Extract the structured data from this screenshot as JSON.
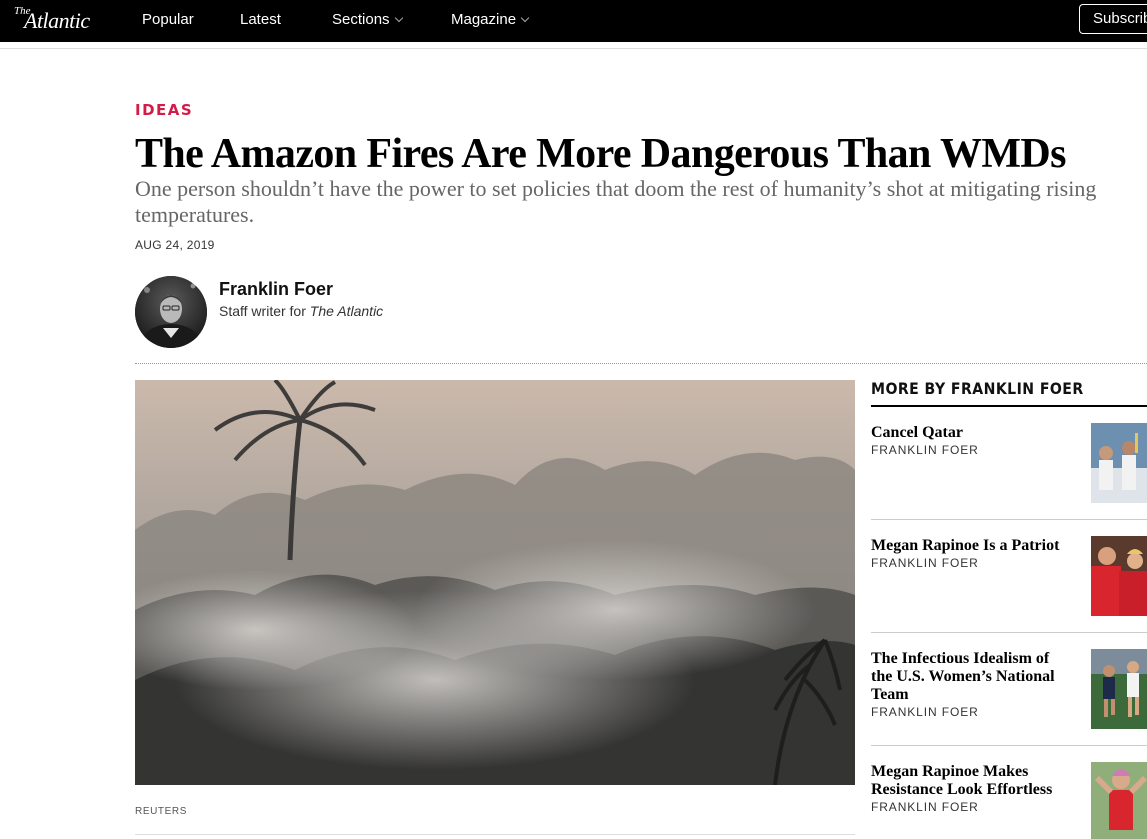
{
  "nav": {
    "logo_the": "The",
    "logo_name": "Atlantic",
    "items": [
      "Popular",
      "Latest",
      "Sections",
      "Magazine"
    ],
    "subscribe_label": "Subscribe"
  },
  "article": {
    "kicker": "IDEAS",
    "headline": "The Amazon Fires Are More Dangerous Than WMDs",
    "dek": "One person shouldn’t have the power to set policies that doom the rest of humanity’s shot at mitigating rising temperatures.",
    "date": "AUG 24, 2019",
    "author_name": "Franklin Foer",
    "author_role_prefix": "Staff writer for ",
    "author_role_pub": "The Atlantic",
    "image_credit": "REUTERS"
  },
  "sidebar": {
    "title": "MORE BY FRANKLIN FOER",
    "items": [
      {
        "title": "Cancel Qatar",
        "author": "FRANKLIN FOER"
      },
      {
        "title": "Megan Rapinoe Is a Patriot",
        "author": "FRANKLIN FOER"
      },
      {
        "title": "The Infectious Idealism of the U.S. Women’s National Team",
        "author": "FRANKLIN FOER"
      },
      {
        "title": "Megan Rapinoe Makes Resistance Look Effortless",
        "author": "FRANKLIN FOER"
      }
    ]
  },
  "colors": {
    "kicker": "#d31b47",
    "nav_bg": "#000000"
  }
}
